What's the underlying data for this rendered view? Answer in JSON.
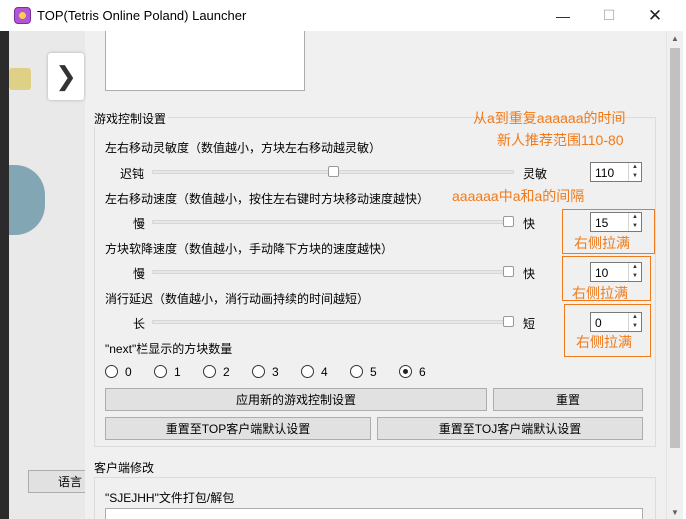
{
  "window": {
    "title": "TOP(Tetris Online Poland) Launcher",
    "minimize_glyph": "—",
    "maximize_glyph": "☐",
    "close_glyph": "✕"
  },
  "background": {
    "language_button_label": "语言",
    "back_button_glyph": "❯"
  },
  "scrollbar": {
    "up_glyph": "▲",
    "down_glyph": "▼"
  },
  "game_control": {
    "group_title": "游戏控制设置",
    "sensitivity": {
      "label": "左右移动灵敏度（数值越小，方块左右移动越灵敏）",
      "left_label": "迟钝",
      "right_label": "灵敏",
      "value": "110",
      "slider_fraction": 0.5
    },
    "move_speed": {
      "label": "左右移动速度（数值越小，按住左右键时方块移动速度越快）",
      "left_label": "慢",
      "right_label": "快",
      "value": "15",
      "slider_fraction": 1.0
    },
    "soft_drop": {
      "label": "方块软降速度（数值越小，手动降下方块的速度越快）",
      "left_label": "慢",
      "right_label": "快",
      "value": "10",
      "slider_fraction": 1.0
    },
    "line_clear_delay": {
      "label": "消行延迟（数值越小，消行动画持续的时间越短）",
      "left_label": "长",
      "right_label": "短",
      "value": "0",
      "slider_fraction": 1.0
    },
    "next_count": {
      "label": "\"next\"栏显示的方块数量",
      "options": [
        "0",
        "1",
        "2",
        "3",
        "4",
        "5",
        "6"
      ],
      "selected": "6"
    },
    "apply_button": "应用新的游戏控制设置",
    "reset_button": "重置",
    "reset_top_button": "重置至TOP客户端默认设置",
    "reset_toj_button": "重置至TOJ客户端默认设置"
  },
  "client_mod": {
    "group_title": "客户端修改",
    "sjejhh_label": "\"SJEJHH\"文件打包/解包"
  },
  "annotations": {
    "repeat_time": "从a到重复aaaaaa的时间",
    "recommend_range": "新人推荐范围110-80",
    "interval": "aaaaaa中a和a的间隔",
    "max_right_1": "右侧拉满",
    "max_right_2": "右侧拉满",
    "max_right_3": "右侧拉满",
    "color": "#f07a1a"
  }
}
